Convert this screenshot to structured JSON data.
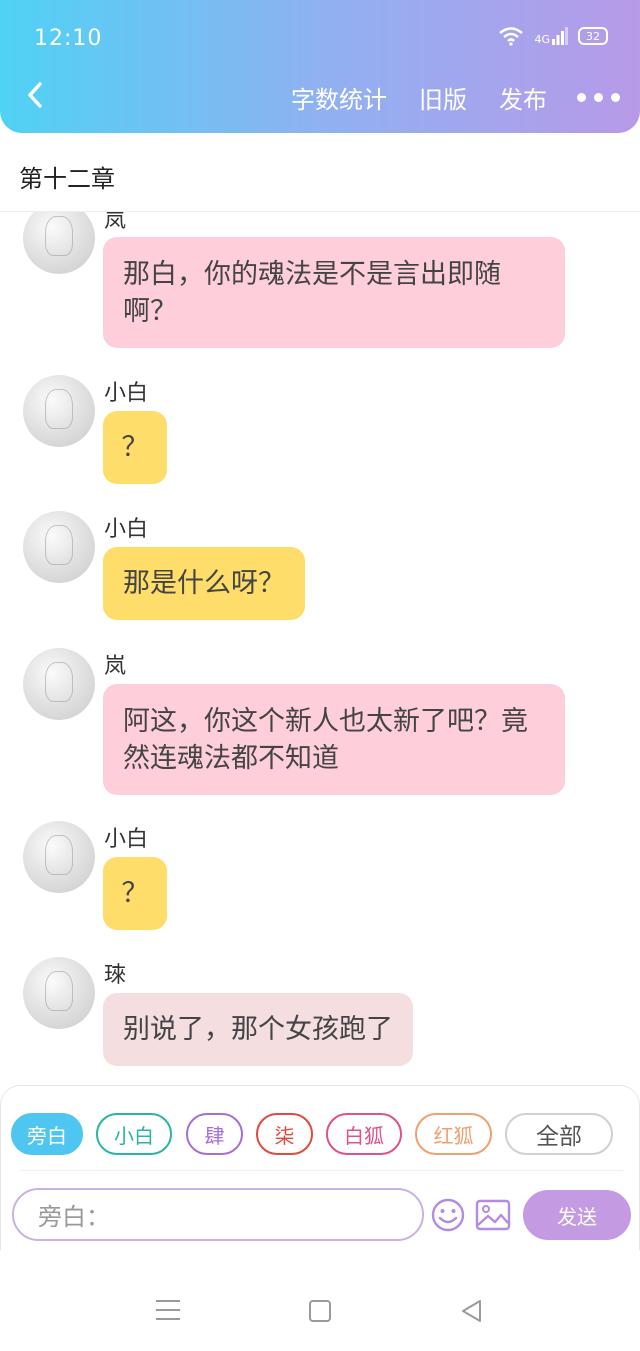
{
  "status_bar": {
    "time": "12:10",
    "signal": "4G",
    "battery": "32"
  },
  "header": {
    "actions": [
      "字数统计",
      "旧版",
      "发布"
    ],
    "icons": {
      "back": "chevron-left-icon",
      "more": "more-dots-icon"
    }
  },
  "chapter": {
    "title": "第十二章"
  },
  "messages": [
    {
      "sender": "岚",
      "text": "那白，你的魂法是不是言出即随啊？",
      "line1": "那白，你的魂法是不是言出即随",
      "line2": "啊？",
      "color": "#fecfdb"
    },
    {
      "sender": "小白",
      "text": "？",
      "color": "#fedd6b"
    },
    {
      "sender": "小白",
      "text": "那是什么呀？",
      "color": "#fedd6b"
    },
    {
      "sender": "岚",
      "text": "阿这，你这个新人也太新了吧？竟然连魂法都不知道",
      "line1": "阿这，你这个新人也太新了吧？竟",
      "line2": "然连魂法都不知道",
      "color": "#fecfdb"
    },
    {
      "sender": "小白",
      "text": "？",
      "color": "#fedd6b"
    },
    {
      "sender": "琜",
      "text": "别说了，那个女孩跑了",
      "color": "#f4dedf"
    }
  ],
  "composer": {
    "roles": [
      {
        "label": "旁白",
        "color": "#4fc6f2",
        "active": true
      },
      {
        "label": "小白",
        "color": "#2bb3a8",
        "active": false
      },
      {
        "label": "肆",
        "color": "#a56fd6",
        "active": false
      },
      {
        "label": "柒",
        "color": "#e04a3f",
        "active": false
      },
      {
        "label": "白狐",
        "color": "#e0508a",
        "active": false
      },
      {
        "label": "红狐",
        "color": "#f0a070",
        "active": false
      },
      {
        "label": "全部",
        "color": "#d0d0d0",
        "active": false
      }
    ],
    "input_placeholder": "旁白：",
    "send_label": "发送",
    "icons": {
      "emoji": "emoji-icon",
      "image": "image-icon"
    }
  },
  "system_nav": {
    "icons": [
      "menu-icon",
      "home-icon",
      "back-triangle-icon"
    ]
  },
  "colors": {
    "header_start": "#4fd2f4",
    "header_end": "#b79ae8",
    "send": "#c49be3"
  }
}
